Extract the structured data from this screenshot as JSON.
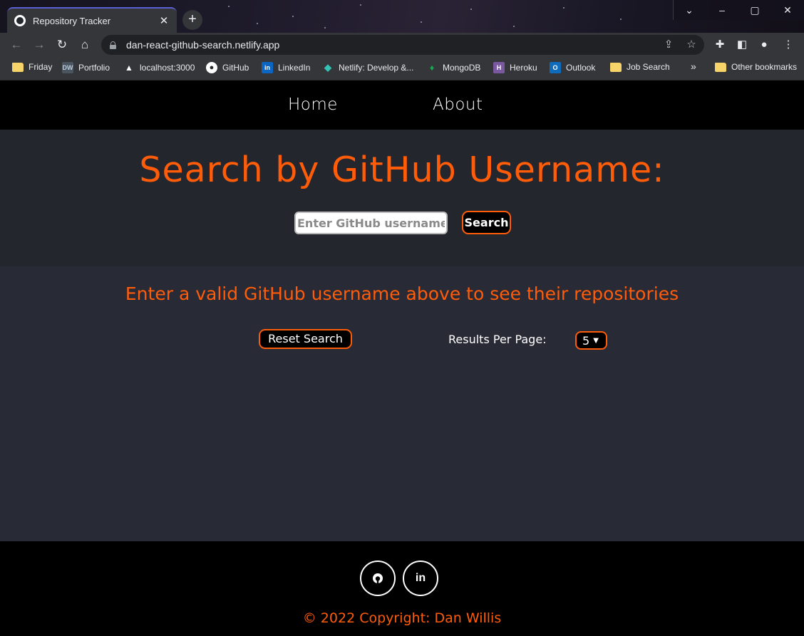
{
  "browser": {
    "tab_title": "Repository Tracker",
    "url": "dan-react-github-search.netlify.app",
    "bookmarks": [
      {
        "label": "Friday",
        "icon": "folder-icon"
      },
      {
        "label": "Portfolio",
        "icon": "dw-icon"
      },
      {
        "label": "localhost:3000",
        "icon": "triangle-icon"
      },
      {
        "label": "GitHub",
        "icon": "github-icon"
      },
      {
        "label": "LinkedIn",
        "icon": "linkedin-icon"
      },
      {
        "label": "Netlify: Develop &...",
        "icon": "netlify-icon"
      },
      {
        "label": "MongoDB",
        "icon": "mongodb-icon"
      },
      {
        "label": "Heroku",
        "icon": "heroku-icon"
      },
      {
        "label": "Outlook",
        "icon": "outlook-icon"
      },
      {
        "label": "Job Search",
        "icon": "folder-icon"
      }
    ],
    "other_bookmarks": "Other bookmarks",
    "overflow": "»"
  },
  "nav": {
    "home": "Home",
    "about": "About"
  },
  "hero": {
    "title": "Search by GitHub Username:",
    "input_value": "",
    "input_placeholder": "Enter GitHub username",
    "search_label": "Search"
  },
  "results": {
    "message": "Enter a valid GitHub username above to see their repositories",
    "reset_label": "Reset Search",
    "per_page_label": "Results Per Page:",
    "per_page_value": "5"
  },
  "footer": {
    "github_icon": "in",
    "copyright": "© 2022 Copyright: Dan Willis"
  },
  "colors": {
    "accent": "#ff5c0a",
    "hero_bg": "#24262d",
    "results_bg": "#282a35"
  }
}
